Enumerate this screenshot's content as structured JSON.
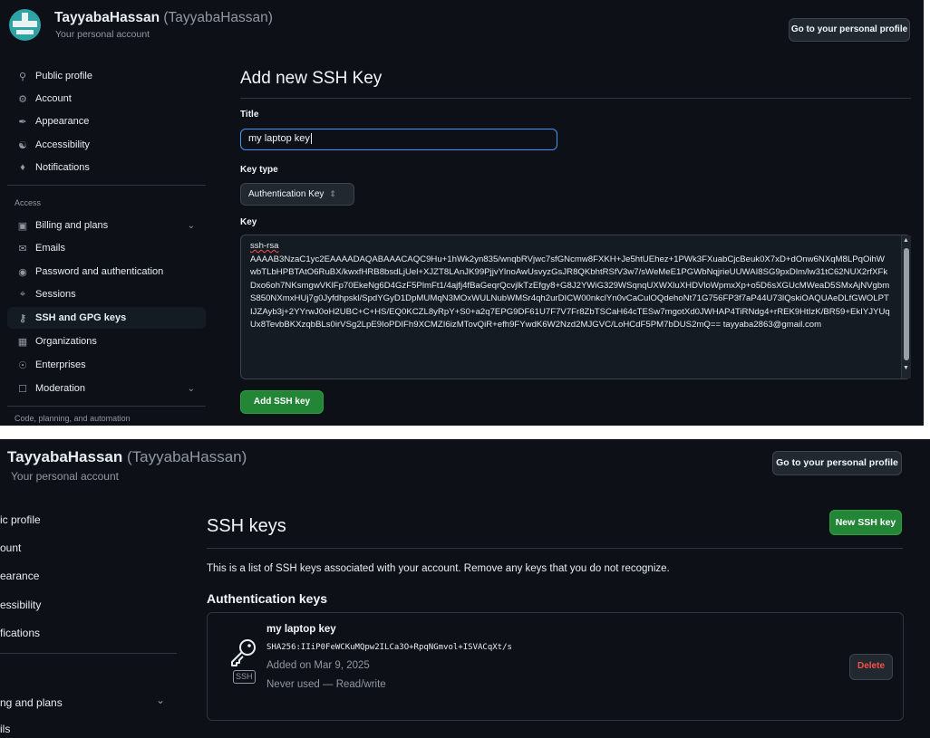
{
  "account": {
    "display_name": "TayyabaHassan",
    "login": "(TayyabaHassan)",
    "subtitle": "Your personal account",
    "profile_button": "Go to your personal profile"
  },
  "sidebar": {
    "items": [
      {
        "label": "Public profile",
        "icon": "person-icon"
      },
      {
        "label": "Account",
        "icon": "gear-icon"
      },
      {
        "label": "Appearance",
        "icon": "paintbrush-icon"
      },
      {
        "label": "Accessibility",
        "icon": "accessibility-icon"
      },
      {
        "label": "Notifications",
        "icon": "bell-icon"
      }
    ],
    "access_label": "Access",
    "access_items": [
      {
        "label": "Billing and plans",
        "icon": "credit-card-icon"
      },
      {
        "label": "Emails",
        "icon": "mail-icon"
      },
      {
        "label": "Password and authentication",
        "icon": "shield-lock-icon"
      },
      {
        "label": "Sessions",
        "icon": "broadcast-icon"
      },
      {
        "label": "SSH and GPG keys",
        "icon": "key-icon"
      },
      {
        "label": "Organizations",
        "icon": "organization-icon"
      },
      {
        "label": "Enterprises",
        "icon": "globe-icon"
      },
      {
        "label": "Moderation",
        "icon": "report-icon"
      }
    ],
    "code_label": "Code, planning, and automation"
  },
  "add_key": {
    "title": "Add new SSH Key",
    "title_label": "Title",
    "title_value": "my laptop key",
    "key_type_label": "Key type",
    "key_type_value": "Authentication Key",
    "key_label": "Key",
    "key_prefix": "ssh-rsa",
    "key_body": "AAAAB3NzaC1yc2EAAAADAQABAAACAQC9Hu+1hWk2yn835/wnqbRVjwc7sfGNcmw8FXKH+Je5htUEhez+1PWk3FXuabCjcBeuk0X7xD+dOnw6NXqM8LPqOihWwbTLbHPBTAtO6RuBX/kwxfHRB8bsdLjUel+XJZT8LAnJK99PjjvYlnoAwUsvyzGsJR8QKbhtRSfV3w7/sWeMeE1PGWbNqjrieUUWAI8SG9pxDlm/lw31tC62NUX2rfXFkDxo6oh7NKsmgwVKlFp70EkeNg6D4GzF5PlmFt1/4ajfj4fBaGeqrQcvjlkTzEfgy8+G8J2YWiG329WSqnqUXWXluXHDVloWpmxXp+o5D6sXGUcMWeaD5SMxAjNVgbmS850NXmxHUj7g0Jyfdhpskl/SpdYGyD1DpMUMqN3MOxWULNubWMSr4qh2urDICW00nkclYn0vCaCulOQdehoNt71G756FP3f7aP44U73lQskiOAQUAeDLfGWOLPTIJZAyb3j+2YYrwJ0oH2UBC+C+HS/EQ0KCZL8yRpY+S0+a2q7EPG9DF61U7F7V7Fr8ZbTSCaH64cTESw7mgotXd0JWHAP4TiRNdg4+rREK9HtIzK/BR59+EkIYJYUqUx8TevbBKXzqbBLs0irVSg2LpE9IoPDIFh9XCMZI6izMTovQiR+efh9FYwdK6W2Nzd2MJGVC/LoHCdF5PM7bDUS2mQ== tayyaba2863@gmail.com",
    "submit_label": "Add SSH key"
  },
  "keys_page": {
    "title": "SSH keys",
    "new_button": "New SSH key",
    "description": "This is a list of SSH keys associated with your account. Remove any keys that you do not recognize.",
    "auth_heading": "Authentication keys",
    "key": {
      "name": "my laptop key",
      "fingerprint": "SHA256:IIiP0FeWCKuMQpw2ILCa3O+RpqNGmvol+ISVACqXt/s",
      "added": "Added on Mar 9, 2025",
      "usage": "Never used — Read/write",
      "badge": "SSH",
      "delete_label": "Delete"
    },
    "nav_fragments": [
      "ic profile",
      "ount",
      "earance",
      "essibility",
      "fications",
      "ng and plans",
      "ils"
    ]
  },
  "colors": {
    "background": "#0d1117",
    "accent_blue": "#4493f8",
    "green": "#238636",
    "danger": "#f85149"
  }
}
